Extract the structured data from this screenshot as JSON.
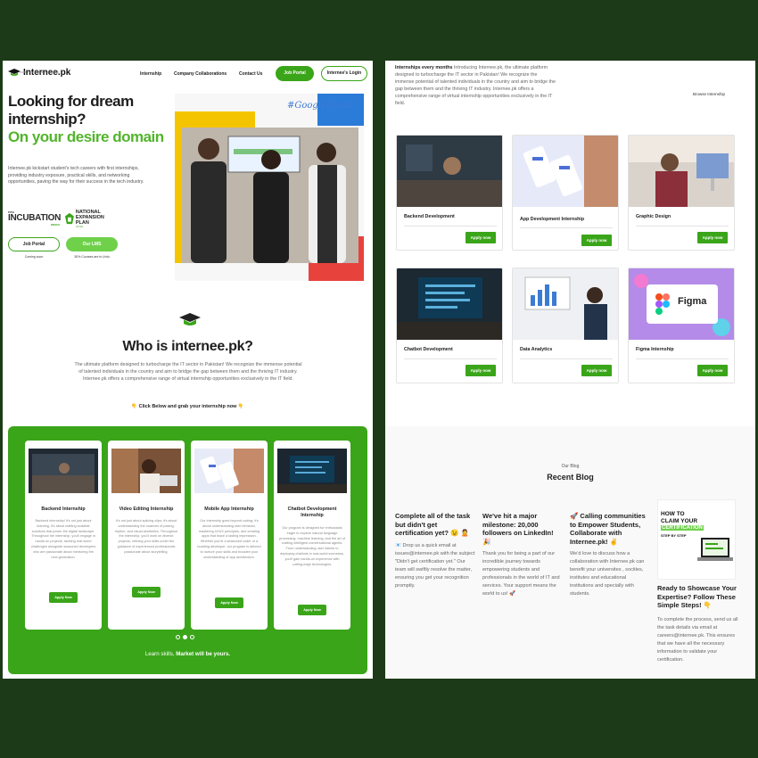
{
  "left": {
    "nav": {
      "logo": "Internee.pk",
      "logo_sub": "YOUR INTERNSHIP PLATFORM",
      "links": [
        "Internship",
        "Company Collaborations",
        "Contact Us"
      ],
      "job_portal": "Job Portal",
      "internee_login": "Internee's Login"
    },
    "hero": {
      "title": "Looking for dream internship?",
      "green_title": "On your desire domain",
      "description": "Internee.pk kickstart student's tech careers with first internships, providing industry exposure, practical skills, and networking opportunities, paving the way for their success in the tech industry.",
      "partner1_small": "PITB",
      "partner1_big": "INCUBATION",
      "partner1_wings": "WINGS",
      "partner2_title": "NATIONAL EXPANSION PLAN",
      "partner2_sub": "OF NIC",
      "btn_job_portal": "Job Portal",
      "btn_lms": "Our LMS",
      "cap_job_portal": "Coming soon",
      "cap_lms": "30% Courses are in Urdu",
      "photo_banner": "#GoogleCloud"
    },
    "who": {
      "title": "Who is internee.pk?",
      "description": "The ultimate platform designed to turbocharge the IT sector in Pakistan! We recognize the immense potential of talented individuals in the country and aim to bridge the gap between them and the thriving IT industry. Internee.pk offers a comprehensive range of virtual internship opportunities exclusively in the IT field.",
      "cta": "👇 Click Below and grab your internship now 👇"
    },
    "courses": [
      {
        "title": "Backend Internship",
        "desc": "Backend internship! It's not just about learning, it's about crafting scalable solutions that power the digital landscape. Throughout the internship, you'll engage in hands-on projects, tackling real-world challenges alongside seasoned developers who are passionate about mentoring the next generation.",
        "button": "Apply Now"
      },
      {
        "title": "Video Editing Internship",
        "desc": "It's not just about splicing clips; it's about understanding the nuances of pacing, rhythm, and visual aesthetics. Throughout the internship, you'll work on diverse projects, refining your skills under the guidance of experienced professionals passionate about storytelling.",
        "button": "Apply Now"
      },
      {
        "title": "Mobile App Internship",
        "desc": "Our internship goes beyond coding; it's about understanding user behavior, mastering UI/UX principles, and creating apps that leave a lasting impression. Whether you're a seasoned coder or a budding developer, our program is tailored to nurture your skills and broaden your understanding of app architecture.",
        "button": "Apply Now"
      },
      {
        "title": "Chatbot Development Internship",
        "desc": "Our program is designed for enthusiasts eager to explore natural language processing, machine learning, and the art of crafting intelligent conversational agents. From understanding user intents to deploying chatbots in real-world scenarios, you'll gain hands-on experience with cutting-edge technologies.",
        "button": "Apply Now"
      }
    ],
    "footer_text": "Learn skills, ",
    "footer_bold": "Market will be yours."
  },
  "right": {
    "intro_bold": "Internships every months",
    "intro_text": " Introducing Internee.pk, the ultimate platform designed to turbocharge the IT sector in Pakistan! We recognize the immense potential of talented individuals in the country and aim to bridge the gap between them and the thriving IT industry. Internee.pk offers a comprehensive range of virtual internship opportunities exclusively in the IT field.",
    "browse": "Browse Internship",
    "internships": [
      {
        "title": "Backend Development",
        "button": "Apply now"
      },
      {
        "title": "App Development Internship",
        "button": "Apply now"
      },
      {
        "title": "Graphic Design",
        "button": "Apply now"
      },
      {
        "title": "Chatbot Development",
        "button": "Apply now"
      },
      {
        "title": "Data Analytics",
        "button": "Apply now"
      },
      {
        "title": "Figma Internship",
        "button": "Apply now"
      }
    ],
    "figma_label": "Figma",
    "blog": {
      "kicker": "Our Blog",
      "title": "Recent Blog",
      "posts": [
        {
          "title": "Complete all of the task but didn't get certification yet? 😉 🙎",
          "body": "📧 Drop us a quick email at issues@internee.pk with the subject \"Didn't get certification yet.\" Our team will swiftly resolve the matter, ensuring you get your recognition promptly."
        },
        {
          "title": "We've hit a major milestone: 20,000 followers on LinkedIn! 🎉",
          "body": "Thank you for being a part of our incredible journey towards empowering students and professionals in the world of IT and services. Your support means the world to us! 🚀"
        },
        {
          "title": "🚀 Calling communities to Empower Students, Collaborate with Internee.pk! ✌",
          "body": "We'd love to discuss how a collaboration with Internee.pk can benefit your universites , socities, institutes and educational institutions and specially with students."
        },
        {
          "title": "Ready to Showcase Your Expertise? Follow These Simple Steps! 👇",
          "body": "To complete the process, send us all the task details via email at careers@internee.pk. This ensures that we have all the necessary information to validate your certification."
        }
      ],
      "thumb_line1": "HOW TO",
      "thumb_line2": "CLAIM YOUR",
      "thumb_line3": "CERTIFICATION",
      "thumb_line4": "STEP BY STEP"
    }
  }
}
